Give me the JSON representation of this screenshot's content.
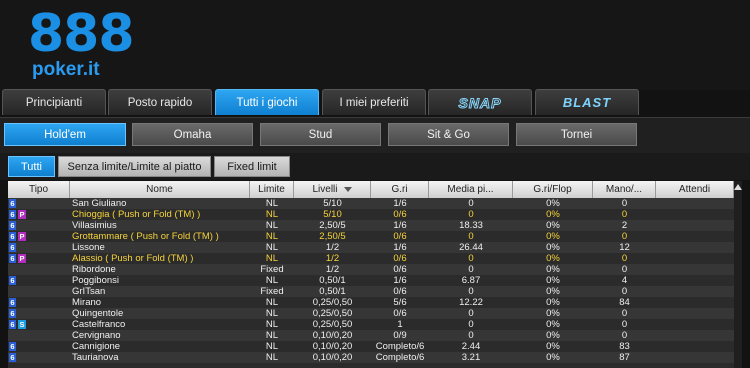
{
  "brand": {
    "logo_number": "888",
    "logo_text": "poker.it"
  },
  "main_tabs": [
    {
      "label": "Principianti",
      "active": false
    },
    {
      "label": "Posto rapido",
      "active": false
    },
    {
      "label": "Tutti i giochi",
      "active": true
    },
    {
      "label": "I miei preferiti",
      "active": false
    },
    {
      "label": "SNAP",
      "active": false
    },
    {
      "label": "BLAST",
      "active": false
    }
  ],
  "game_tabs": [
    {
      "label": "Hold'em",
      "active": true
    },
    {
      "label": "Omaha",
      "active": false
    },
    {
      "label": "Stud",
      "active": false
    },
    {
      "label": "Sit & Go",
      "active": false
    },
    {
      "label": "Tornei",
      "active": false
    }
  ],
  "filter_tabs": [
    {
      "label": "Tutti",
      "active": true
    },
    {
      "label": "Senza limite/Limite al piatto",
      "active": false
    },
    {
      "label": "Fixed limit",
      "active": false
    }
  ],
  "table": {
    "columns": [
      "Tipo",
      "Nome",
      "Limite",
      "Livelli",
      "G.ri",
      "Media pi...",
      "G.ri/Flop",
      "Mano/...",
      "Attendi"
    ],
    "sorted_column": "Livelli",
    "rows": [
      {
        "tipo": [
          "6"
        ],
        "nome": "San Giuliano",
        "limite": "NL",
        "livelli": "5/10",
        "giri": "1/6",
        "media": "0",
        "flop": "0%",
        "mano": "0",
        "attendi": "",
        "highlight": false
      },
      {
        "tipo": [
          "6",
          "P"
        ],
        "nome": "Chioggia ( Push or Fold (TM) )",
        "limite": "NL",
        "livelli": "5/10",
        "giri": "0/6",
        "media": "0",
        "flop": "0%",
        "mano": "0",
        "attendi": "",
        "highlight": true
      },
      {
        "tipo": [
          "6"
        ],
        "nome": "Villasimius",
        "limite": "NL",
        "livelli": "2,50/5",
        "giri": "1/6",
        "media": "18.33",
        "flop": "0%",
        "mano": "2",
        "attendi": "",
        "highlight": false
      },
      {
        "tipo": [
          "6",
          "P"
        ],
        "nome": "Grottammare ( Push or Fold (TM) )",
        "limite": "NL",
        "livelli": "2,50/5",
        "giri": "0/6",
        "media": "0",
        "flop": "0%",
        "mano": "0",
        "attendi": "",
        "highlight": true
      },
      {
        "tipo": [
          "6"
        ],
        "nome": "Lissone",
        "limite": "NL",
        "livelli": "1/2",
        "giri": "1/6",
        "media": "26.44",
        "flop": "0%",
        "mano": "12",
        "attendi": "",
        "highlight": false
      },
      {
        "tipo": [
          "6",
          "P"
        ],
        "nome": "Alassio ( Push or Fold (TM) )",
        "limite": "NL",
        "livelli": "1/2",
        "giri": "0/6",
        "media": "0",
        "flop": "0%",
        "mano": "0",
        "attendi": "",
        "highlight": true
      },
      {
        "tipo": [],
        "nome": "Ribordone",
        "limite": "Fixed",
        "livelli": "1/2",
        "giri": "0/6",
        "media": "0",
        "flop": "0%",
        "mano": "0",
        "attendi": "",
        "highlight": false
      },
      {
        "tipo": [
          "6"
        ],
        "nome": "Poggibonsi",
        "limite": "NL",
        "livelli": "0,50/1",
        "giri": "1/6",
        "media": "6.87",
        "flop": "0%",
        "mano": "4",
        "attendi": "",
        "highlight": false
      },
      {
        "tipo": [],
        "nome": "GrITsan",
        "limite": "Fixed",
        "livelli": "0,50/1",
        "giri": "0/6",
        "media": "0",
        "flop": "0%",
        "mano": "0",
        "attendi": "",
        "highlight": false
      },
      {
        "tipo": [
          "6"
        ],
        "nome": "Mirano",
        "limite": "NL",
        "livelli": "0,25/0,50",
        "giri": "5/6",
        "media": "12.22",
        "flop": "0%",
        "mano": "84",
        "attendi": "",
        "highlight": false
      },
      {
        "tipo": [
          "6"
        ],
        "nome": "Quingentole",
        "limite": "NL",
        "livelli": "0,25/0,50",
        "giri": "0/6",
        "media": "0",
        "flop": "0%",
        "mano": "0",
        "attendi": "",
        "highlight": false
      },
      {
        "tipo": [
          "6",
          "S"
        ],
        "nome": "Castelfranco",
        "limite": "NL",
        "livelli": "0,25/0,50",
        "giri": "1",
        "media": "0",
        "flop": "0%",
        "mano": "0",
        "attendi": "",
        "highlight": false
      },
      {
        "tipo": [],
        "nome": "Cervignano",
        "limite": "NL",
        "livelli": "0,10/0,20",
        "giri": "0/9",
        "media": "0",
        "flop": "0%",
        "mano": "0",
        "attendi": "",
        "highlight": false
      },
      {
        "tipo": [
          "6"
        ],
        "nome": "Cannigione",
        "limite": "NL",
        "livelli": "0,10/0,20",
        "giri": "Completo/6",
        "media": "2.44",
        "flop": "0%",
        "mano": "83",
        "attendi": "",
        "highlight": false
      },
      {
        "tipo": [
          "6"
        ],
        "nome": "Taurianova",
        "limite": "NL",
        "livelli": "0,10/0,20",
        "giri": "Completo/6",
        "media": "3.21",
        "flop": "0%",
        "mano": "87",
        "attendi": "",
        "highlight": false
      }
    ]
  },
  "colors": {
    "accent": "#1b8fe3",
    "highlight_text": "#f5d33a",
    "badge_six": "#2b5fd6",
    "badge_push": "#b22cc0",
    "badge_snap": "#1a9de0"
  }
}
